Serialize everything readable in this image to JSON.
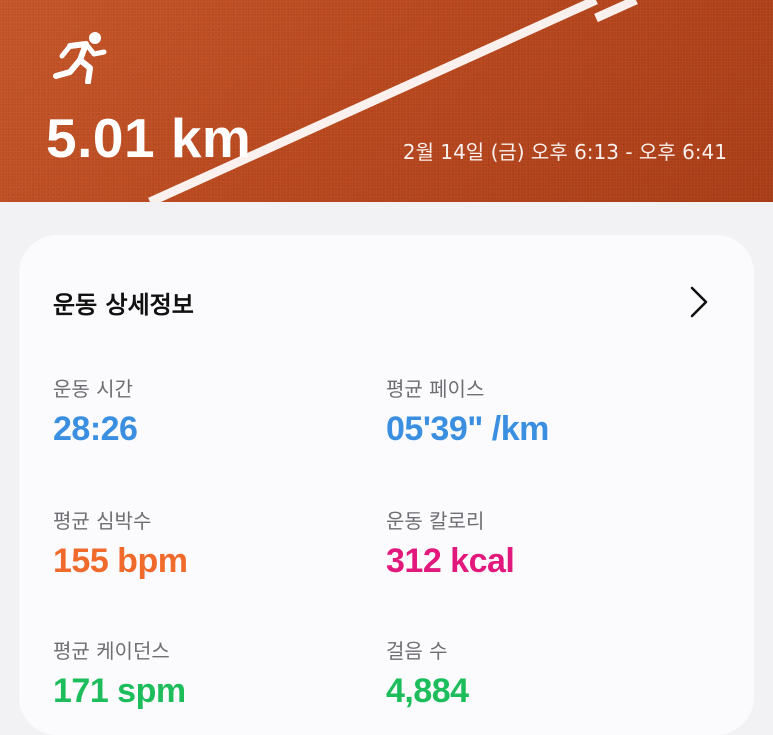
{
  "header": {
    "distance": "5.01 km",
    "time_range": "2월 14일 (금) 오후 6:13 - 오후 6:41",
    "activity_icon": "running-person-icon"
  },
  "card": {
    "title": "운동 상세정보",
    "chevron_icon": "chevron-right-icon",
    "metrics": [
      {
        "label": "운동 시간",
        "value": "28:26",
        "color": "#3a8fe0"
      },
      {
        "label": "평균 페이스",
        "value": "05'39\" /km",
        "color": "#3a8fe0"
      },
      {
        "label": "평균 심박수",
        "value": "155 bpm",
        "color": "#f06a2c"
      },
      {
        "label": "운동 칼로리",
        "value": "312 kcal",
        "color": "#e2197d"
      },
      {
        "label": "평균 케이던스",
        "value": "171 spm",
        "color": "#1ebd5c"
      },
      {
        "label": "걸음 수",
        "value": "4,884",
        "color": "#1ebd5c"
      }
    ]
  }
}
